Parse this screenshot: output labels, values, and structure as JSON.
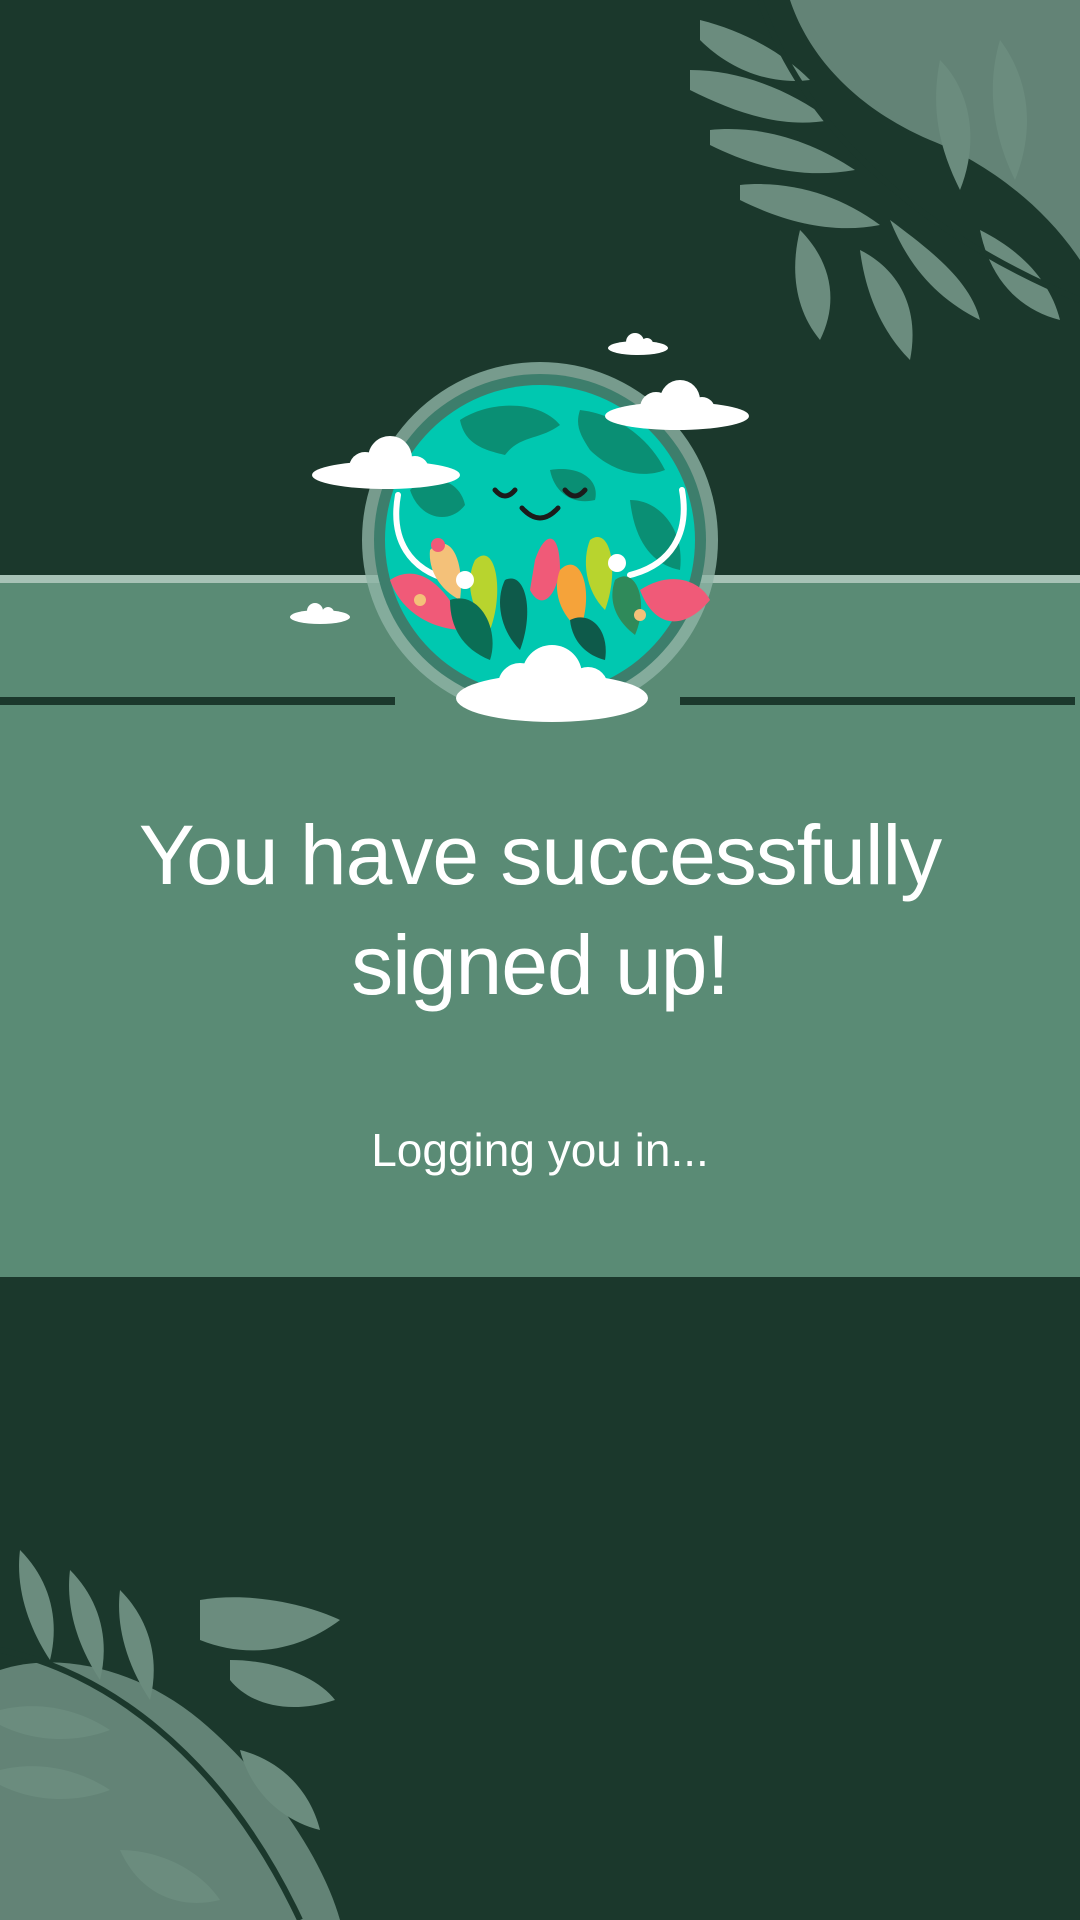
{
  "colors": {
    "background": "#1b382c",
    "card": "#5a8b75",
    "card_border": "#a7c2b6",
    "leaf": "#6b8c7e",
    "text": "#ffffff"
  },
  "illustration": {
    "icon": "earth-meditating-illustration"
  },
  "main": {
    "title": "You have successfully signed up!",
    "status": "Logging you in..."
  }
}
